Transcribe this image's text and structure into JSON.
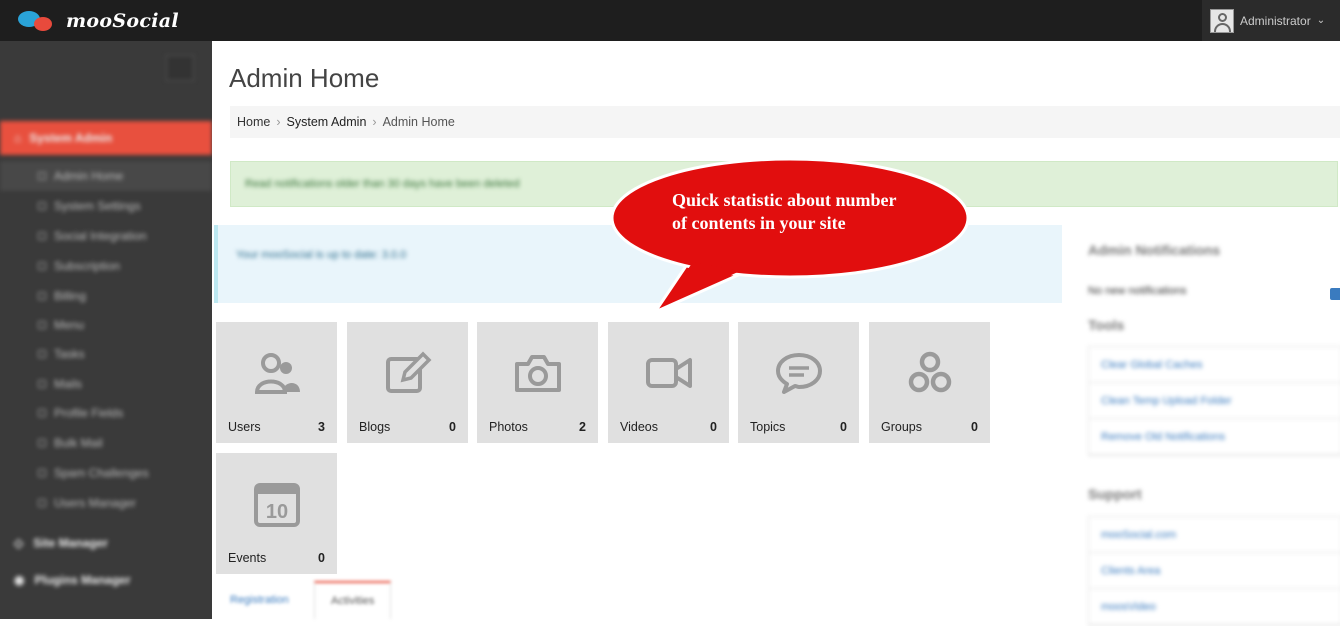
{
  "topbar": {
    "logo_text": "mooSocial",
    "user_name": "Administrator"
  },
  "sidebar": {
    "sections": [
      {
        "label": "System Admin",
        "active": true
      },
      {
        "label": "Site Manager",
        "active": false
      },
      {
        "label": "Plugins Manager",
        "active": false
      }
    ],
    "items": [
      {
        "label": "Admin Home",
        "current": true
      },
      {
        "label": "System Settings"
      },
      {
        "label": "Social Integration"
      },
      {
        "label": "Subscription"
      },
      {
        "label": "Billing"
      },
      {
        "label": "Menu"
      },
      {
        "label": "Tasks"
      },
      {
        "label": "Mails"
      },
      {
        "label": "Profile Fields"
      },
      {
        "label": "Bulk Mail"
      },
      {
        "label": "Spam Challenges"
      },
      {
        "label": "Users Manager"
      }
    ]
  },
  "main": {
    "title": "Admin Home",
    "breadcrumb": [
      "Home",
      "System Admin",
      "Admin Home"
    ],
    "alert_success": "Read notifications older than 30 days have been deleted",
    "alert_info": "Your mooSocial is up to date: 3.0.0"
  },
  "stats": [
    {
      "label": "Users",
      "value": "3",
      "icon": "users-icon"
    },
    {
      "label": "Blogs",
      "value": "0",
      "icon": "edit-icon"
    },
    {
      "label": "Photos",
      "value": "2",
      "icon": "camera-icon"
    },
    {
      "label": "Videos",
      "value": "0",
      "icon": "video-camera-icon"
    },
    {
      "label": "Topics",
      "value": "0",
      "icon": "comment-icon"
    },
    {
      "label": "Groups",
      "value": "0",
      "icon": "groups-icon"
    },
    {
      "label": "Events",
      "value": "0",
      "icon": "calendar-icon",
      "calendar_day": "10"
    }
  ],
  "tabs": [
    "Registration",
    "Activities"
  ],
  "right_panel": {
    "notifications_title": "Admin Notifications",
    "no_notifications": "No new notifications",
    "tools_title": "Tools",
    "tools": [
      "Clear Global Caches",
      "Clean Temp Upload Folder",
      "Remove Old Notifications"
    ],
    "support_title": "Support",
    "support_links": [
      "mooSocial.com",
      "Clients Area",
      "moosVideo"
    ]
  },
  "callout": {
    "line1": "Quick statistic about number",
    "line2": "of contents in your site"
  },
  "colors": {
    "accent": "#e8503e",
    "callout_red": "#e10e0e",
    "tile_bg": "#e0e0e0",
    "icon_gray": "#9a9a9a"
  }
}
